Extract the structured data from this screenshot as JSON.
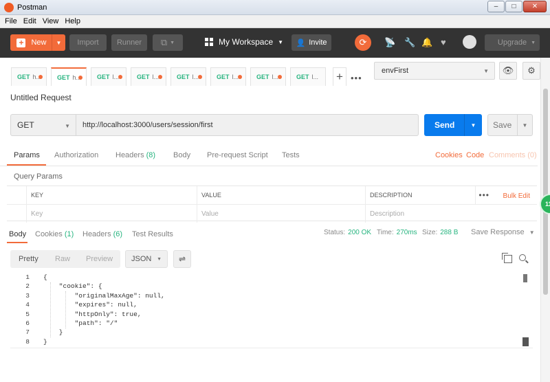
{
  "window": {
    "title": "Postman",
    "controls": {
      "minimize": "–",
      "maximize": "□",
      "close": "✕"
    }
  },
  "menu": [
    "File",
    "Edit",
    "View",
    "Help"
  ],
  "header": {
    "new_label": "New",
    "import_label": "Import",
    "runner_label": "Runner",
    "workspace_label": "My Workspace",
    "invite_label": "Invite",
    "upgrade_label": "Upgrade",
    "icons": [
      "sync-icon",
      "satellite-icon",
      "wrench-icon",
      "bell-icon",
      "heart-icon",
      "avatar-icon"
    ]
  },
  "tabs": [
    {
      "method": "GET",
      "name": "h...",
      "modified": true,
      "active": false
    },
    {
      "method": "GET",
      "name": "h...",
      "modified": true,
      "active": true
    },
    {
      "method": "GET",
      "name": "l...",
      "modified": true,
      "active": false
    },
    {
      "method": "GET",
      "name": "l...",
      "modified": true,
      "active": false
    },
    {
      "method": "GET",
      "name": "l...",
      "modified": true,
      "active": false
    },
    {
      "method": "GET",
      "name": "l...",
      "modified": true,
      "active": false
    },
    {
      "method": "GET",
      "name": "l...",
      "modified": true,
      "active": false
    },
    {
      "method": "GET",
      "name": "l...",
      "modified": false,
      "active": false
    }
  ],
  "environment": {
    "selected": "envFirst"
  },
  "request": {
    "title": "Untitled Request",
    "method": "GET",
    "url": "http://localhost:3000/users/session/first",
    "send_label": "Send",
    "save_label": "Save"
  },
  "request_tabs": {
    "params": "Params",
    "authorization": "Authorization",
    "headers": "Headers",
    "headers_count": "(8)",
    "body": "Body",
    "prerequest": "Pre-request Script",
    "tests": "Tests",
    "cookies": "Cookies",
    "code": "Code",
    "comments": "Comments (0)"
  },
  "query_params": {
    "title": "Query Params",
    "columns": {
      "key": "KEY",
      "value": "VALUE",
      "description": "DESCRIPTION"
    },
    "bulk_edit": "Bulk Edit",
    "placeholders": {
      "key": "Key",
      "value": "Value",
      "description": "Description"
    }
  },
  "response_tabs": {
    "body": "Body",
    "cookies": "Cookies",
    "cookies_count": "(1)",
    "headers": "Headers",
    "headers_count": "(6)",
    "test_results": "Test Results"
  },
  "response_status": {
    "status_label": "Status:",
    "status_value": "200 OK",
    "time_label": "Time:",
    "time_value": "270ms",
    "size_label": "Size:",
    "size_value": "288 B",
    "save_response": "Save Response"
  },
  "view": {
    "pretty": "Pretty",
    "raw": "Raw",
    "preview": "Preview",
    "format": "JSON"
  },
  "code_lines": [
    {
      "n": "1",
      "text": "{"
    },
    {
      "n": "2",
      "text": "    \"cookie\": {"
    },
    {
      "n": "3",
      "text": "        \"originalMaxAge\": null,"
    },
    {
      "n": "4",
      "text": "        \"expires\": null,"
    },
    {
      "n": "5",
      "text": "        \"httpOnly\": true,"
    },
    {
      "n": "6",
      "text": "        \"path\": \"/\""
    },
    {
      "n": "7",
      "text": "    }"
    },
    {
      "n": "8",
      "text": "}"
    }
  ],
  "bubble_text": "11",
  "colors": {
    "accent": "#f26b3a",
    "send_blue": "#097bed",
    "success_green": "#26b47f",
    "header_bg": "#333333"
  }
}
